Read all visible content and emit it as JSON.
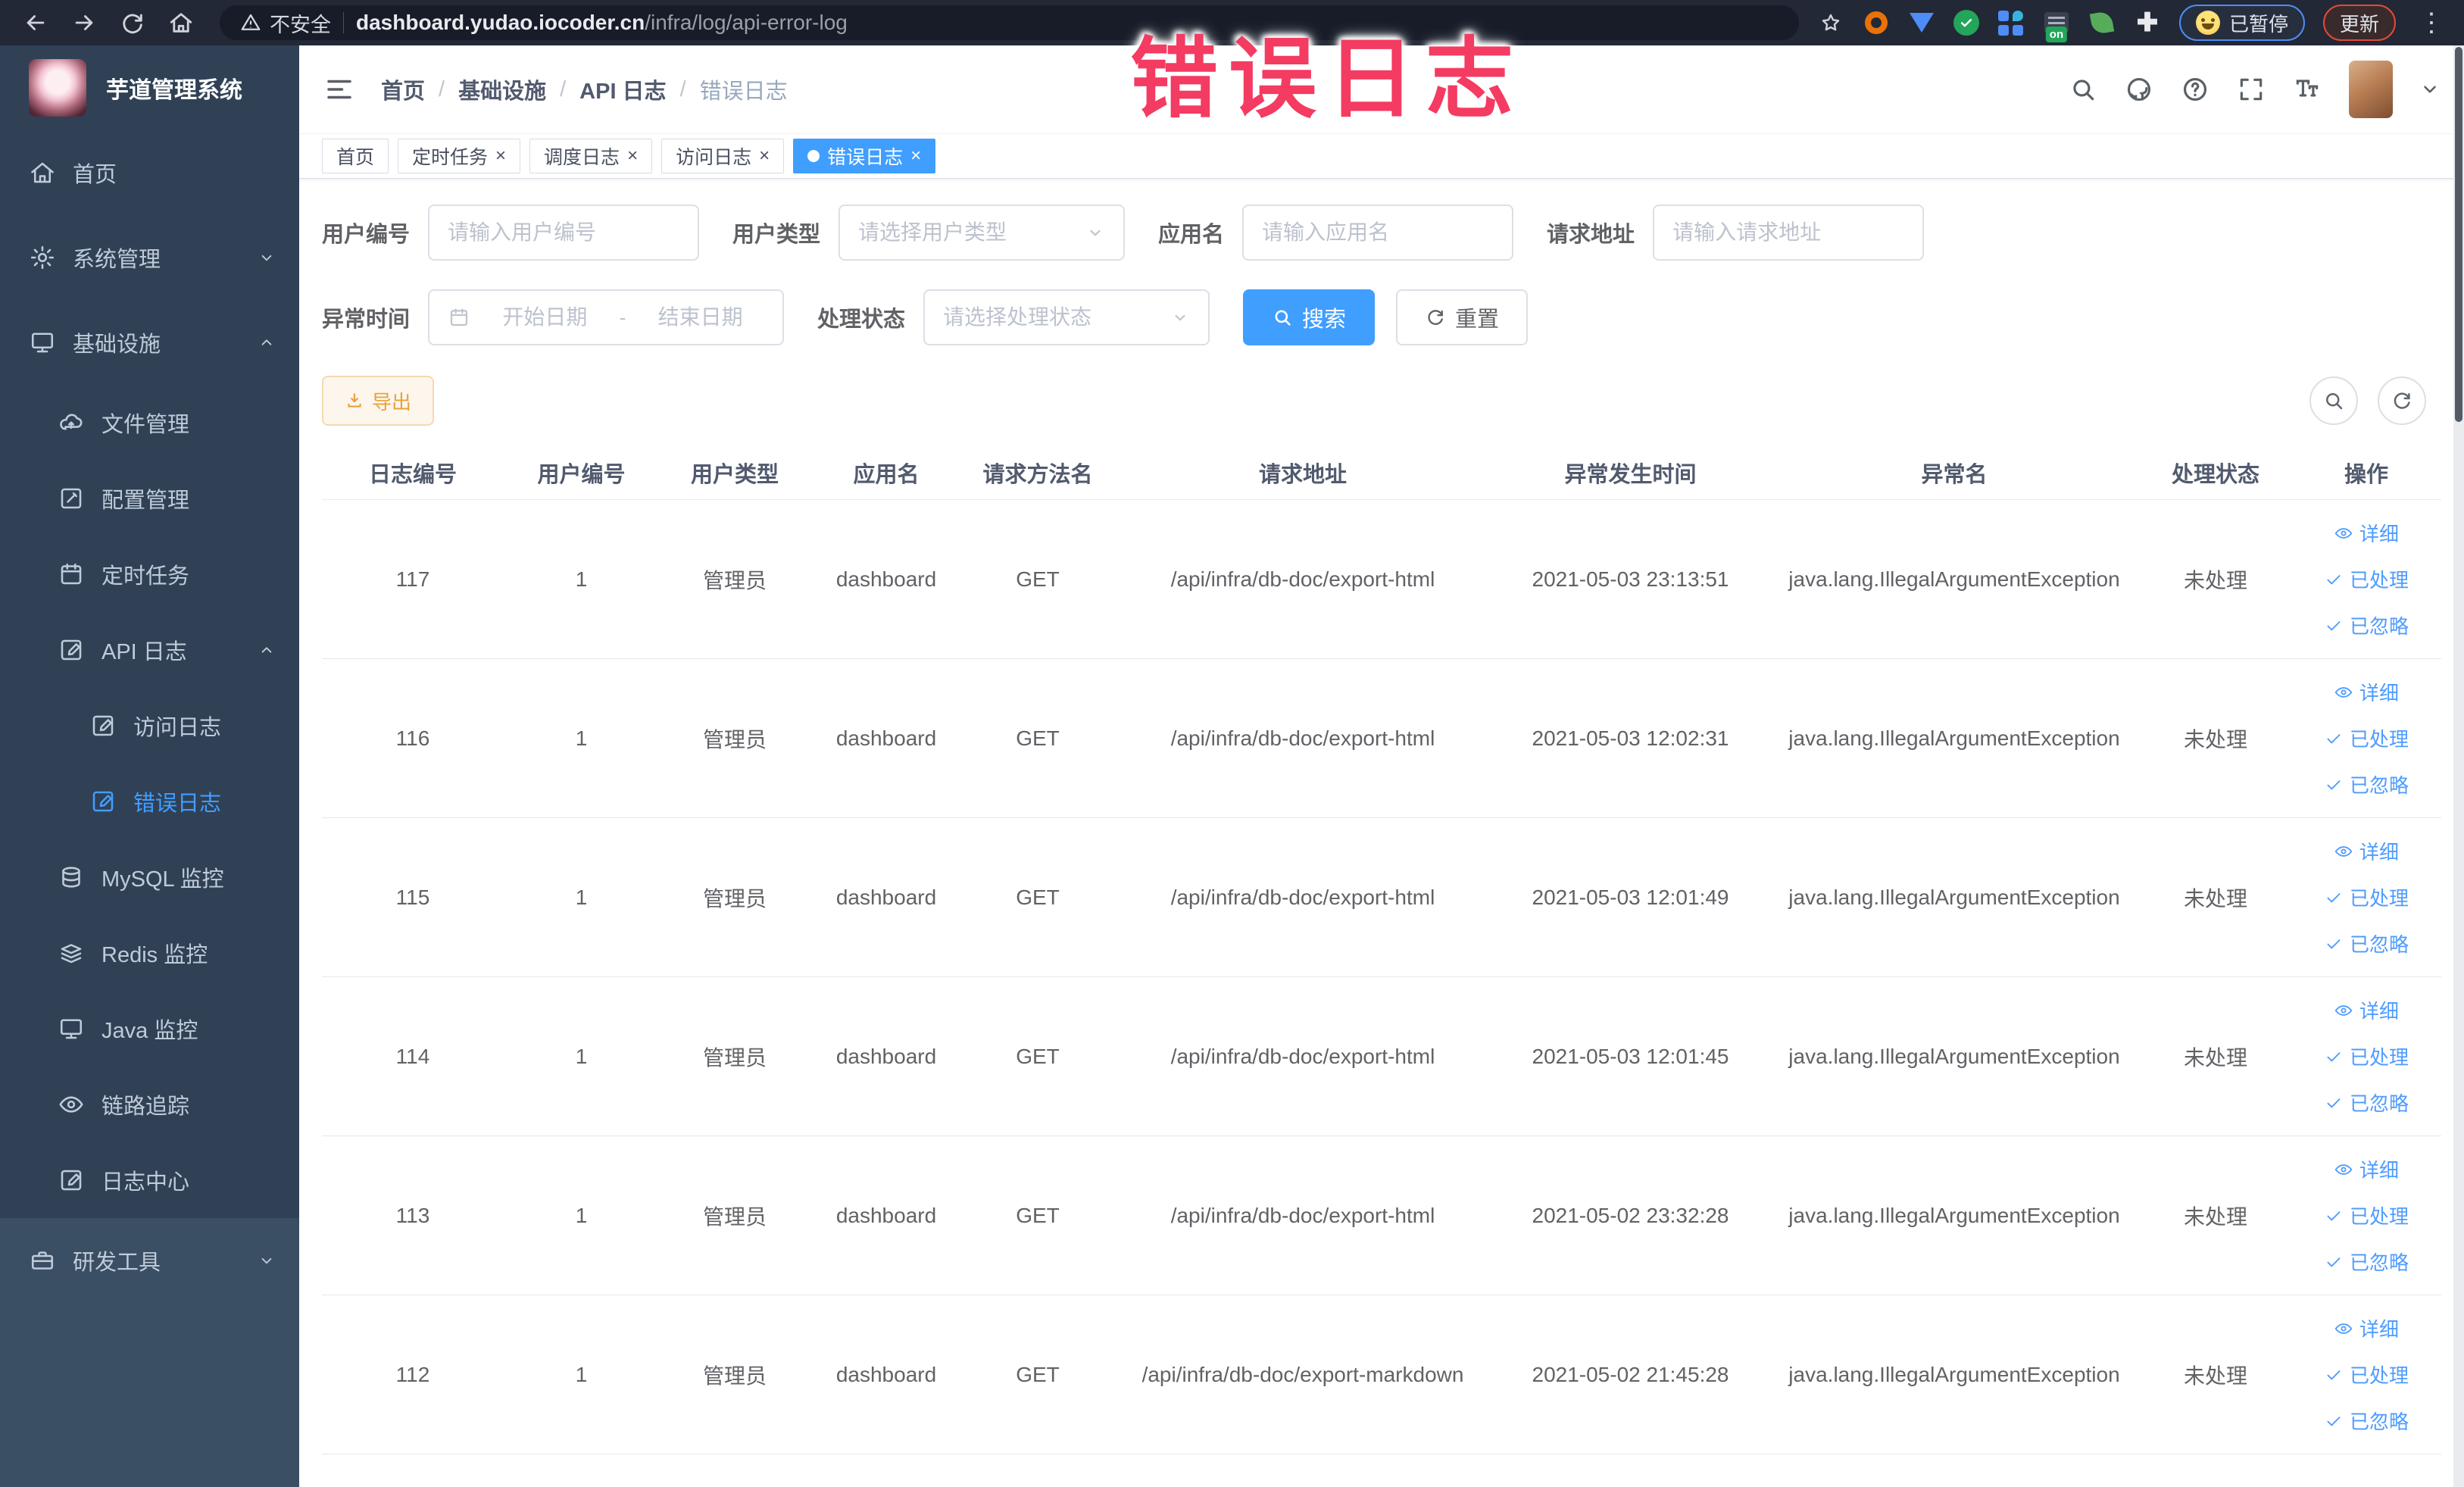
{
  "browser": {
    "security_label": "不安全",
    "url_host": "dashboard.yudao.iocoder.cn",
    "url_path": "/infra/log/api-error-log",
    "extension_badge": "on",
    "paused_chip": "已暂停",
    "update_chip": "更新"
  },
  "overlay": {
    "title": "错误日志"
  },
  "sidebar": {
    "app_title": "芋道管理系统",
    "items": [
      {
        "label": "首页",
        "icon": "home",
        "level": 1
      },
      {
        "label": "系统管理",
        "icon": "gear",
        "level": 1,
        "chevron": "down"
      },
      {
        "label": "基础设施",
        "icon": "monitor",
        "level": 1,
        "chevron": "up"
      },
      {
        "label": "文件管理",
        "icon": "cloud-upload",
        "level": 2
      },
      {
        "label": "配置管理",
        "icon": "edit-square",
        "level": 2
      },
      {
        "label": "定时任务",
        "icon": "calendar",
        "level": 2
      },
      {
        "label": "API 日志",
        "icon": "log",
        "level": 2,
        "chevron": "up"
      },
      {
        "label": "访问日志",
        "icon": "log",
        "level": 3
      },
      {
        "label": "错误日志",
        "icon": "log",
        "level": 3,
        "active": true
      },
      {
        "label": "MySQL 监控",
        "icon": "database",
        "level": 2
      },
      {
        "label": "Redis 监控",
        "icon": "layers",
        "level": 2
      },
      {
        "label": "Java 监控",
        "icon": "monitor",
        "level": 2
      },
      {
        "label": "链路追踪",
        "icon": "eye",
        "level": 2
      },
      {
        "label": "日志中心",
        "icon": "log",
        "level": 2
      },
      {
        "label": "研发工具",
        "icon": "toolbox",
        "level": 1,
        "chevron": "down",
        "section": "bottom"
      }
    ]
  },
  "header": {
    "breadcrumb": [
      "首页",
      "基础设施",
      "API 日志",
      "错误日志"
    ]
  },
  "tabs": [
    {
      "label": "首页",
      "closable": false,
      "active": false
    },
    {
      "label": "定时任务",
      "closable": true,
      "active": false
    },
    {
      "label": "调度日志",
      "closable": true,
      "active": false
    },
    {
      "label": "访问日志",
      "closable": true,
      "active": false
    },
    {
      "label": "错误日志",
      "closable": true,
      "active": true
    }
  ],
  "filters": {
    "user_id": {
      "label": "用户编号",
      "placeholder": "请输入用户编号"
    },
    "user_type": {
      "label": "用户类型",
      "placeholder": "请选择用户类型"
    },
    "app_name": {
      "label": "应用名",
      "placeholder": "请输入应用名"
    },
    "request_url": {
      "label": "请求地址",
      "placeholder": "请输入请求地址"
    },
    "exception_time": {
      "label": "异常时间",
      "start_placeholder": "开始日期",
      "separator": "-",
      "end_placeholder": "结束日期"
    },
    "process_status": {
      "label": "处理状态",
      "placeholder": "请选择处理状态"
    },
    "search_label": "搜索",
    "reset_label": "重置"
  },
  "toolbar": {
    "export_label": "导出"
  },
  "table": {
    "columns": [
      "日志编号",
      "用户编号",
      "用户类型",
      "应用名",
      "请求方法名",
      "请求地址",
      "异常发生时间",
      "异常名",
      "处理状态",
      "操作"
    ],
    "row_actions": [
      "详细",
      "已处理",
      "已忽略"
    ],
    "rows": [
      {
        "id": "117",
        "user_id": "1",
        "user_type": "管理员",
        "app": "dashboard",
        "method": "GET",
        "url": "/api/infra/db-doc/export-html",
        "time": "2021-05-03 23:13:51",
        "exception": "java.lang.IllegalArgumentException",
        "status": "未处理"
      },
      {
        "id": "116",
        "user_id": "1",
        "user_type": "管理员",
        "app": "dashboard",
        "method": "GET",
        "url": "/api/infra/db-doc/export-html",
        "time": "2021-05-03 12:02:31",
        "exception": "java.lang.IllegalArgumentException",
        "status": "未处理"
      },
      {
        "id": "115",
        "user_id": "1",
        "user_type": "管理员",
        "app": "dashboard",
        "method": "GET",
        "url": "/api/infra/db-doc/export-html",
        "time": "2021-05-03 12:01:49",
        "exception": "java.lang.IllegalArgumentException",
        "status": "未处理"
      },
      {
        "id": "114",
        "user_id": "1",
        "user_type": "管理员",
        "app": "dashboard",
        "method": "GET",
        "url": "/api/infra/db-doc/export-html",
        "time": "2021-05-03 12:01:45",
        "exception": "java.lang.IllegalArgumentException",
        "status": "未处理"
      },
      {
        "id": "113",
        "user_id": "1",
        "user_type": "管理员",
        "app": "dashboard",
        "method": "GET",
        "url": "/api/infra/db-doc/export-html",
        "time": "2021-05-02 23:32:28",
        "exception": "java.lang.IllegalArgumentException",
        "status": "未处理"
      },
      {
        "id": "112",
        "user_id": "1",
        "user_type": "管理员",
        "app": "dashboard",
        "method": "GET",
        "url": "/api/infra/db-doc/export-markdown",
        "time": "2021-05-02 21:45:28",
        "exception": "java.lang.IllegalArgumentException",
        "status": "未处理"
      }
    ]
  }
}
